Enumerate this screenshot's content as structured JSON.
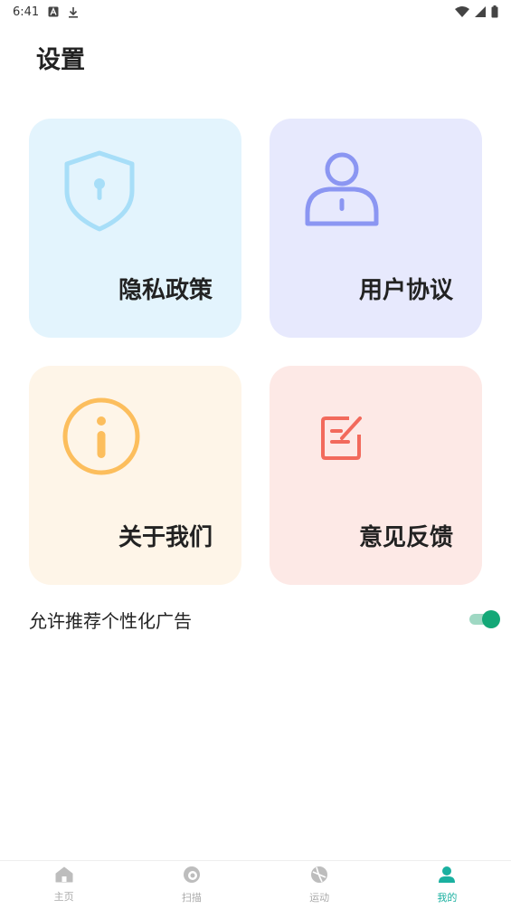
{
  "status_bar": {
    "time": "6:41"
  },
  "page": {
    "title": "设置"
  },
  "cards": {
    "privacy": {
      "label": "隐私政策"
    },
    "agreement": {
      "label": "用户协议"
    },
    "about": {
      "label": "关于我们"
    },
    "feedback": {
      "label": "意见反馈"
    }
  },
  "settings": {
    "personalized_ads": {
      "label": "允许推荐个性化广告",
      "enabled": true
    }
  },
  "bottom_nav": {
    "items": [
      {
        "label": "主页",
        "icon": "home-icon"
      },
      {
        "label": "扫描",
        "icon": "scan-icon"
      },
      {
        "label": "运动",
        "icon": "ball-icon"
      },
      {
        "label": "我的",
        "icon": "person-icon",
        "active": true
      }
    ]
  },
  "colors": {
    "privacy_bg": "#e3f4fd",
    "agreement_bg": "#e7e9fd",
    "about_bg": "#fef5e8",
    "feedback_bg": "#fde9e6",
    "accent": "#13a877",
    "nav_active": "#1ab0a0"
  }
}
